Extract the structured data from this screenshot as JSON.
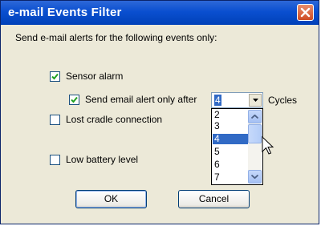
{
  "window": {
    "title": "e-mail Events Filter",
    "close_icon": "close-icon"
  },
  "content": {
    "intro": "Send e-mail alerts for the following events only:",
    "sensor_alarm": {
      "label": "Sensor alarm",
      "checked": true
    },
    "email_after": {
      "label": "Send email alert only after",
      "checked": true,
      "suffix": "Cycles"
    },
    "cycles_select": {
      "value": "4",
      "options": [
        "2",
        "3",
        "4",
        "5",
        "6",
        "7"
      ],
      "selected_index": 2
    },
    "lost_cradle": {
      "label": "Lost cradle connection",
      "checked": false
    },
    "low_battery": {
      "label": "Low battery level",
      "checked": false
    }
  },
  "buttons": {
    "ok": "OK",
    "cancel": "Cancel"
  },
  "colors": {
    "titlebar": "#0a4fd0",
    "selection": "#316ac5",
    "dialog_bg": "#ece9d8",
    "close": "#cf4b23"
  }
}
